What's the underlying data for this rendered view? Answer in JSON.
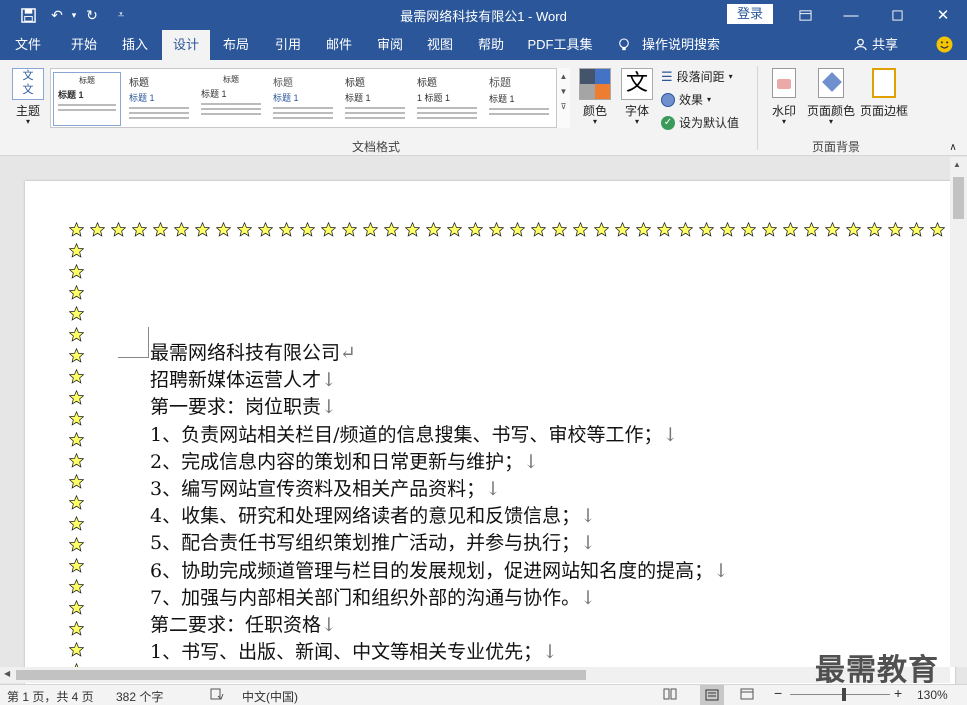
{
  "window": {
    "title": "最需网络科技有限公1 - Word",
    "login": "登录"
  },
  "tabs": [
    "文件",
    "开始",
    "插入",
    "设计",
    "布局",
    "引用",
    "邮件",
    "审阅",
    "视图",
    "帮助",
    "PDF工具集"
  ],
  "tell_me": "操作说明搜索",
  "share": "共享",
  "ribbon": {
    "theme_label": "主题",
    "gallery": [
      {
        "title": "标题",
        "heading": "标题 1"
      },
      {
        "title": "标题",
        "heading": "标题 1"
      },
      {
        "title": "标题",
        "heading": "标题 1"
      },
      {
        "title": "标题",
        "heading": "标题 1"
      },
      {
        "title": "标题",
        "heading": "标题 1"
      },
      {
        "title": "标题",
        "heading": "1 标题 1"
      },
      {
        "title": "标题",
        "heading": "标题 1"
      }
    ],
    "colors_label": "颜色",
    "fonts_label": "字体",
    "paragraph_spacing": "段落间距",
    "effects": "效果",
    "set_default": "设为默认值",
    "doc_format_group": "文档格式",
    "watermark": "水印",
    "page_color": "页面颜色",
    "page_border": "页面边框",
    "page_bg_group": "页面背景"
  },
  "document": {
    "lines": [
      {
        "text": "最需网络科技有限公司",
        "mark": "↵"
      },
      {
        "text": "招聘新媒体运营人才",
        "mark": "↓"
      },
      {
        "text": "第一要求：岗位职责",
        "mark": "↓"
      },
      {
        "text": "1、负责网站相关栏目/频道的信息搜集、书写、审校等工作；",
        "mark": "↓"
      },
      {
        "text": "2、完成信息内容的策划和日常更新与维护；",
        "mark": "↓"
      },
      {
        "text": "3、编写网站宣传资料及相关产品资料；",
        "mark": "↓"
      },
      {
        "text": "4、收集、研究和处理网络读者的意见和反馈信息；",
        "mark": "↓"
      },
      {
        "text": "5、配合责任书写组织策划推广活动，并参与执行；",
        "mark": "↓"
      },
      {
        "text": "6、协助完成频道管理与栏目的发展规划，促进网站知名度的提高；",
        "mark": "↓"
      },
      {
        "text": "7、加强与内部相关部门和组织外部的沟通与协作。",
        "mark": "↓"
      },
      {
        "text": "第二要求：任职资格",
        "mark": "↓"
      },
      {
        "text": "1、书写、出版、新闻、中文等相关专业优先；",
        "mark": "↓"
      }
    ]
  },
  "status": {
    "page": "第 1 页，共 4 页",
    "words": "382 个字",
    "lang": "中文(中国)",
    "zoom": "130%"
  },
  "watermark_text": "最需教育"
}
